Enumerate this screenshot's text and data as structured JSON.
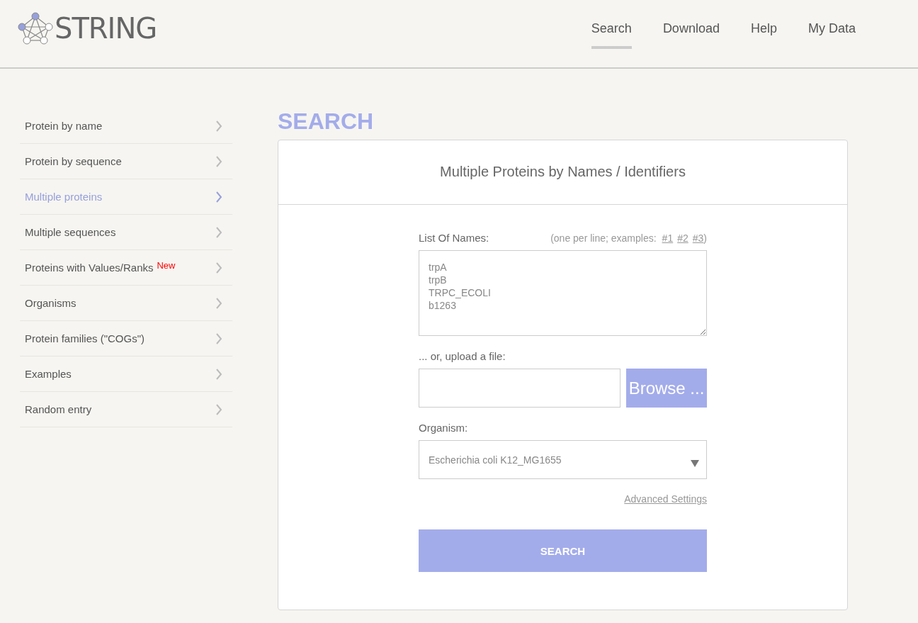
{
  "logo": {
    "text": "STRING"
  },
  "nav": [
    {
      "label": "Search",
      "selected": true
    },
    {
      "label": "Download",
      "selected": false
    },
    {
      "label": "Help",
      "selected": false
    },
    {
      "label": "My Data",
      "selected": false
    }
  ],
  "sidebar": {
    "items": [
      {
        "label": "Protein by name",
        "selected": false
      },
      {
        "label": "Protein by sequence",
        "selected": false
      },
      {
        "label": "Multiple proteins",
        "selected": true
      },
      {
        "label": "Multiple sequences",
        "selected": false
      },
      {
        "label": "Proteins with Values/Ranks",
        "selected": false,
        "badge": "New"
      },
      {
        "label": "Organisms",
        "selected": false
      },
      {
        "label": "Protein families (\"COGs\")",
        "selected": false
      },
      {
        "label": "Examples",
        "selected": false
      },
      {
        "label": "Random entry",
        "selected": false
      }
    ]
  },
  "page_title": "SEARCH",
  "card": {
    "title": "Multiple Proteins by Names / Identifiers",
    "names_label": "List Of Names:",
    "examples_prefix": "(one per line; examples:",
    "examples": [
      "#1",
      "#2",
      "#3"
    ],
    "examples_suffix": ")",
    "names_value": "trpA\ntrpB\nTRPC_ECOLI\nb1263",
    "upload_label": "... or, upload a file:",
    "browse_button": "Browse ...",
    "organism_label": "Organism:",
    "organism_value": "Escherichia coli K12_MG1655",
    "advanced_link": "Advanced Settings",
    "search_button": "SEARCH"
  }
}
